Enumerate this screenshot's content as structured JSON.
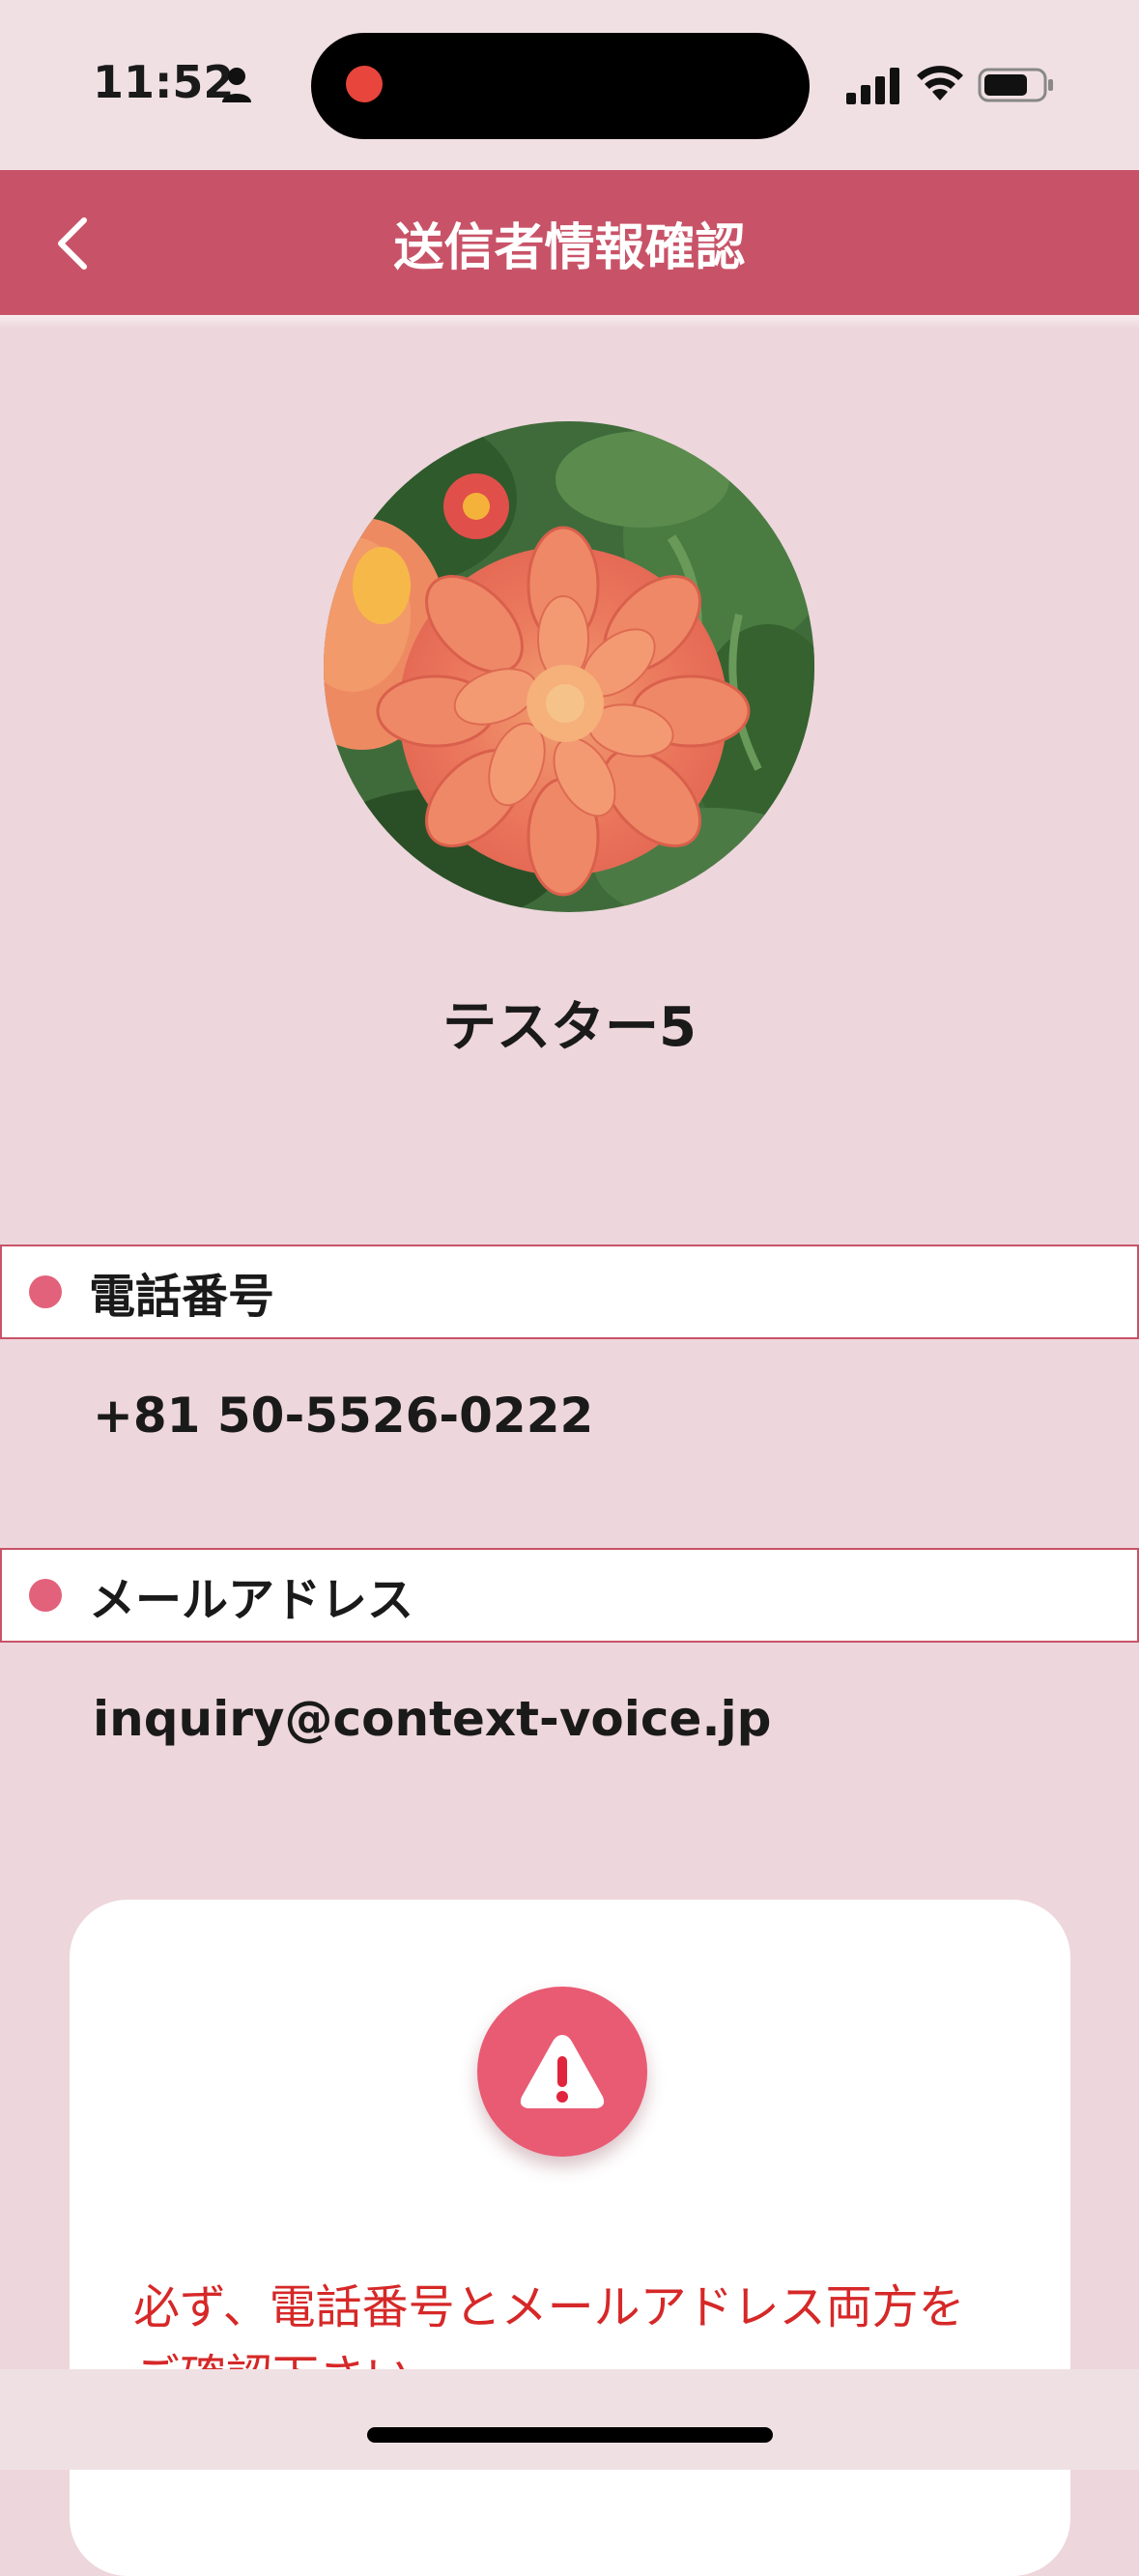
{
  "status_bar": {
    "time": "11:52",
    "icons": [
      "person-icon",
      "recording-dot",
      "signal-icon",
      "wifi-icon",
      "battery-icon"
    ]
  },
  "nav": {
    "title": "送信者情報確認",
    "back_icon": "chevron-left-icon"
  },
  "profile": {
    "avatar_alt": "dahlia-flower-photo",
    "name": "テスター5"
  },
  "sections": {
    "phone": {
      "label": "電話番号",
      "value": "+81 50-5526-0222"
    },
    "email": {
      "label": "メールアドレス",
      "value": "inquiry@context-voice.jp"
    }
  },
  "notice": {
    "icon": "warning-icon",
    "text": "必ず、電話番号とメールアドレス両方をご確認下さい。"
  },
  "colors": {
    "accent": "#c85368",
    "background": "#edd6dc",
    "bullet": "#e2617b",
    "alert_badge": "#e95a73",
    "notice_text": "#d62828"
  }
}
